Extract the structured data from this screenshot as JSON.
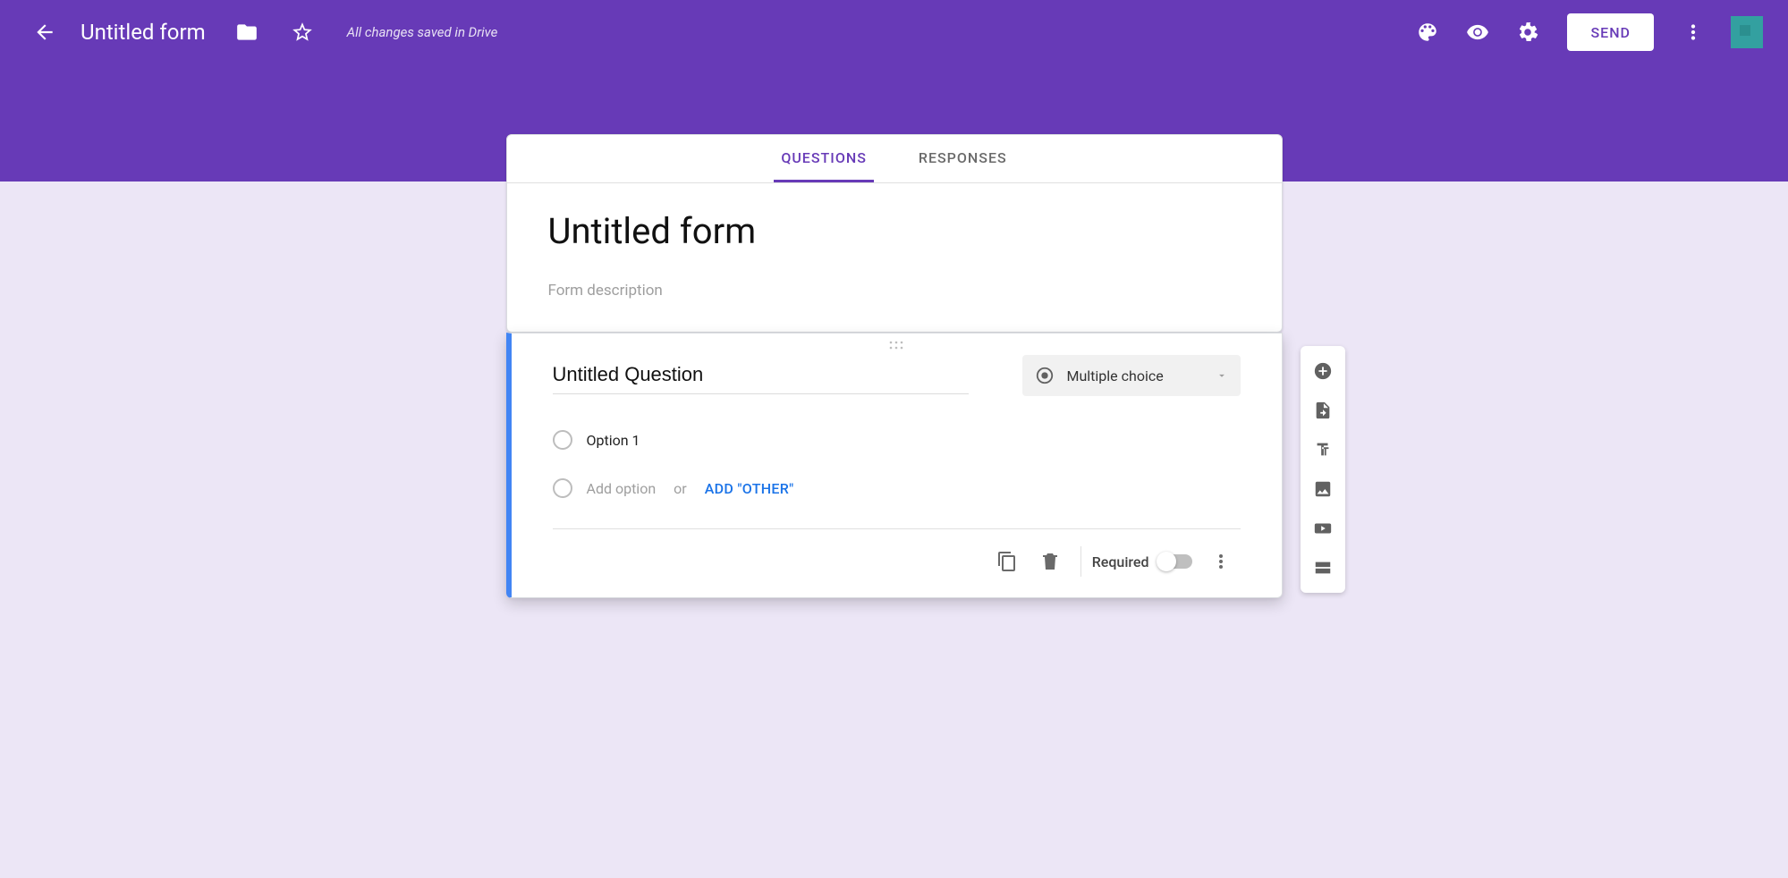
{
  "header": {
    "title": "Untitled form",
    "save_status": "All changes saved in Drive",
    "send_label": "SEND"
  },
  "tabs": {
    "questions": "QUESTIONS",
    "responses": "RESPONSES",
    "active": "questions"
  },
  "form": {
    "title": "Untitled form",
    "description_placeholder": "Form description"
  },
  "question": {
    "title": "Untitled Question",
    "type_label": "Multiple choice",
    "options": [
      {
        "label": "Option 1"
      }
    ],
    "add_option_placeholder": "Add option",
    "or_text": "or",
    "add_other_label": "ADD \"OTHER\"",
    "required_label": "Required",
    "required": false
  }
}
